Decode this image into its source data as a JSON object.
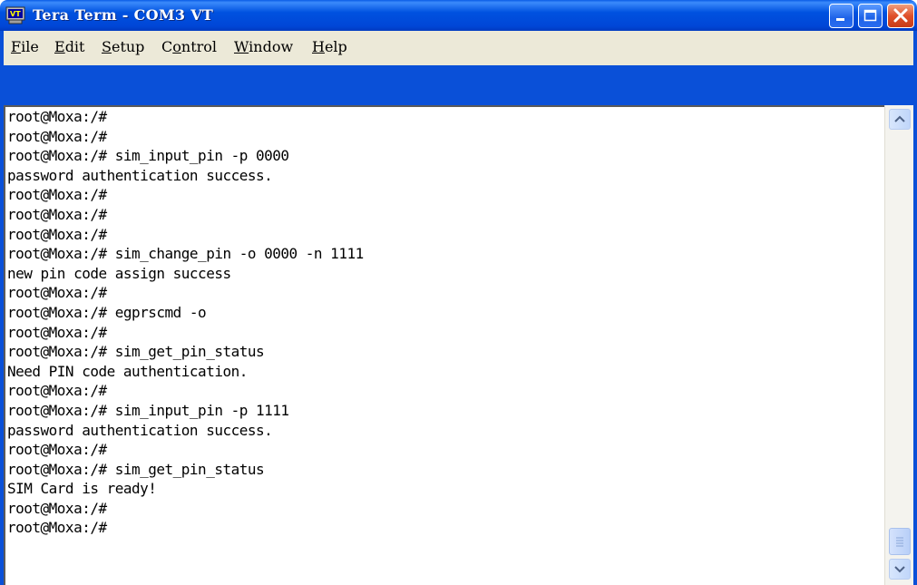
{
  "window": {
    "title": "Tera Term - COM3 VT",
    "app_icon": "teraterm-vt-icon",
    "controls": [
      "minimize-icon",
      "maximize-icon",
      "close-icon"
    ],
    "colors": {
      "titlebar": "#0052e0",
      "close": "#e0502a",
      "frame": "#0a50d8"
    }
  },
  "menu": {
    "items": [
      {
        "label": "File",
        "mnemonic": "F"
      },
      {
        "label": "Edit",
        "mnemonic": "E"
      },
      {
        "label": "Setup",
        "mnemonic": "S"
      },
      {
        "label": "Control",
        "mnemonic": "o"
      },
      {
        "label": "Window",
        "mnemonic": "W"
      },
      {
        "label": "Help",
        "mnemonic": "H"
      }
    ]
  },
  "terminal": {
    "lines": [
      "root@Moxa:/#",
      "root@Moxa:/#",
      "root@Moxa:/# sim_input_pin -p 0000",
      "password authentication success.",
      "root@Moxa:/#",
      "root@Moxa:/#",
      "root@Moxa:/#",
      "root@Moxa:/# sim_change_pin -o 0000 -n 1111",
      "new pin code assign success",
      "root@Moxa:/#",
      "root@Moxa:/# egprscmd -o",
      "root@Moxa:/#",
      "root@Moxa:/# sim_get_pin_status",
      "Need PIN code authentication.",
      "root@Moxa:/#",
      "root@Moxa:/# sim_input_pin -p 1111",
      "password authentication success.",
      "root@Moxa:/#",
      "root@Moxa:/# sim_get_pin_status",
      "SIM Card is ready!",
      "root@Moxa:/#",
      "root@Moxa:/#"
    ]
  },
  "scrollbar": {
    "up_icon": "scroll-up-arrow-icon",
    "down_icon": "scroll-down-arrow-icon",
    "position": 1.0
  }
}
